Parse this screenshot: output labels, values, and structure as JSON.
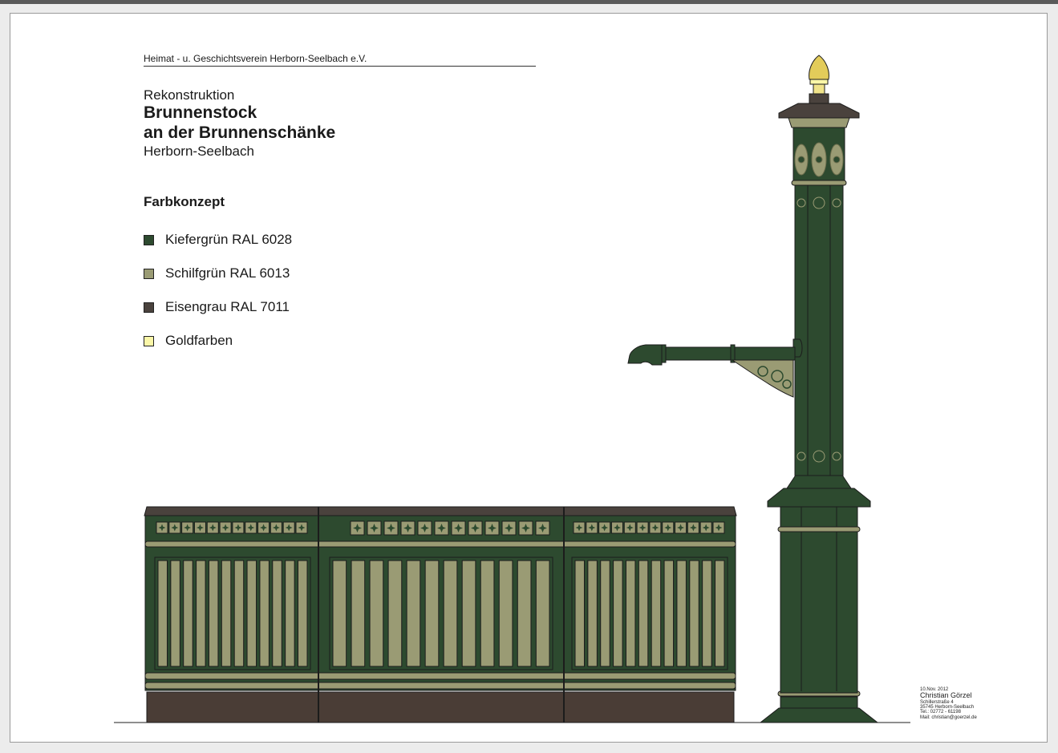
{
  "header": {
    "organization": "Heimat - u. Geschichtsverein Herborn-Seelbach e.V.",
    "subtitle": "Rekonstruktion",
    "title_line1": "Brunnenstock",
    "title_line2": "an der Brunnenschänke",
    "location": "Herborn-Seelbach"
  },
  "legend": {
    "heading": "Farbkonzept",
    "items": [
      {
        "label": "Kiefergrün RAL 6028",
        "color": "#2d4a2f"
      },
      {
        "label": "Schilfgrün RAL 6013",
        "color": "#9a9b74"
      },
      {
        "label": "Eisengrau RAL 7011",
        "color": "#4a423d"
      },
      {
        "label": "Goldfarben",
        "color": "#fbf7a8"
      }
    ]
  },
  "credit": {
    "date": "10.Nov. 2012",
    "name": "Christian Görzel",
    "street": "Schillerstraße 4",
    "city": "35745 Herborn-Seelbach",
    "phone": "Tel.: 02772 - 61198",
    "mail": "Mail: christian@goerzel.de"
  },
  "colors": {
    "pine_green": "#2d4a2f",
    "reed_green": "#9a9b74",
    "iron_grey": "#4a423d",
    "gold": "#fbf7a8",
    "trough_base": "#4a3d36",
    "outline": "#1c1c1c"
  }
}
